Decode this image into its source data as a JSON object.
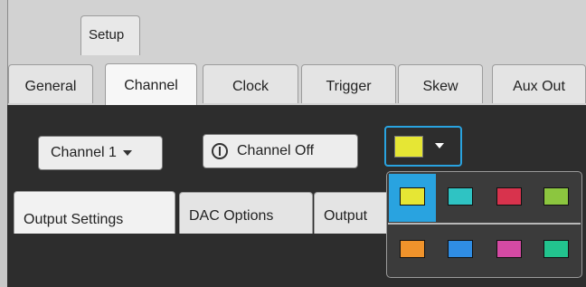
{
  "window": {
    "setup_tab": "Setup",
    "tabs": [
      "General",
      "Channel",
      "Clock",
      "Trigger",
      "Skew",
      "Aux Out"
    ],
    "active_tab": "Channel"
  },
  "channel_panel": {
    "channel_select": "Channel 1",
    "channel_toggle": "Channel Off",
    "selected_color": "#e6e634"
  },
  "sub_tabs": [
    "Output Settings",
    "DAC Options",
    "Output"
  ],
  "active_sub_tab": "Output Settings",
  "color_palette": {
    "row1": [
      "#e6e634",
      "#2fc3c3",
      "#d8334d",
      "#8cc63f"
    ],
    "row2": [
      "#f0932b",
      "#2f8de4",
      "#d54aa4",
      "#22c48e"
    ],
    "selected_index": 0
  },
  "colors": {
    "accent": "#29a3e0",
    "panel_bg": "#2d2d2d"
  }
}
